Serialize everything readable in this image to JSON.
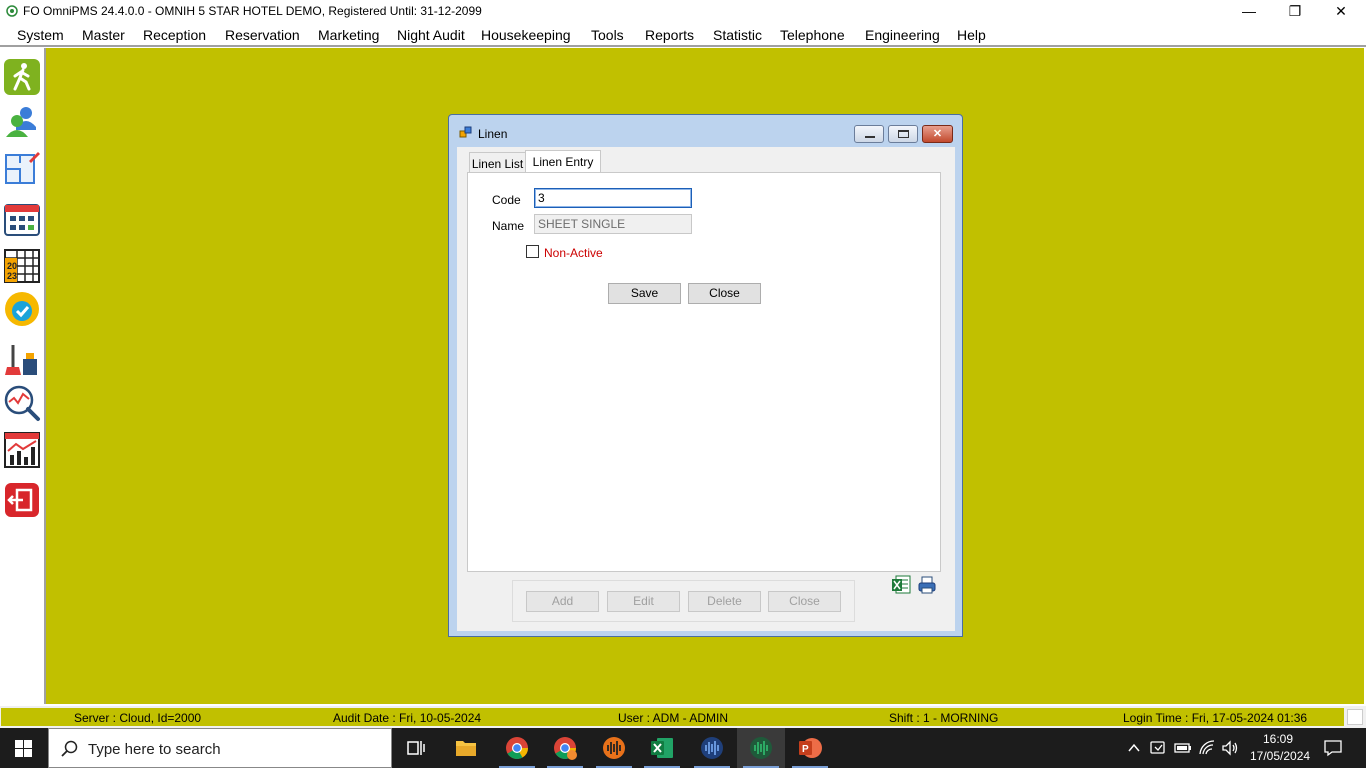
{
  "app": {
    "title": "FO OmniPMS 24.4.0.0 - OMNIH 5 STAR HOTEL DEMO, Registered Until: 31-12-2099",
    "window_controls": {
      "minimize": "—",
      "maximize": "❐",
      "close": "✕"
    }
  },
  "menu": {
    "items": [
      "System",
      "Master",
      "Reception",
      "Reservation",
      "Marketing",
      "Night Audit",
      "Housekeeping",
      "Tools",
      "Reports",
      "Statistic",
      "Telephone",
      "Engineering",
      "Help"
    ]
  },
  "sidebar": {
    "icons": [
      "walk-in-icon",
      "guests-icon",
      "floor-plan-icon",
      "room-grid-icon",
      "calendar-2023-icon",
      "available-check-icon",
      "housekeeping-icon",
      "search-analytics-icon",
      "statistics-chart-icon",
      "exit-icon"
    ]
  },
  "dialog": {
    "title": "Linen",
    "tabs": {
      "list": "Linen List",
      "entry": "Linen Entry"
    },
    "form": {
      "code_label": "Code",
      "code_value": "3",
      "name_label": "Name",
      "name_value": "SHEET SINGLE",
      "nonactive_label": "Non-Active",
      "nonactive_checked": false
    },
    "buttons": {
      "save": "Save",
      "close": "Close"
    },
    "bottom_buttons": {
      "add": "Add",
      "edit": "Edit",
      "delete": "Delete",
      "close": "Close"
    },
    "accent_color": "#cc0000"
  },
  "status": {
    "server": "Server : Cloud, Id=2000",
    "audit_date": "Audit Date : Fri, 10-05-2024",
    "user": "User : ADM - ADMIN",
    "shift": "Shift : 1 - MORNING",
    "login_time": "Login Time : Fri, 17-05-2024 01:36"
  },
  "taskbar": {
    "search_placeholder": "Type here to search",
    "time": "16:09",
    "date": "17/05/2024"
  },
  "colors": {
    "desktop": "#c1c000",
    "taskbar": "#1c1c1c"
  }
}
